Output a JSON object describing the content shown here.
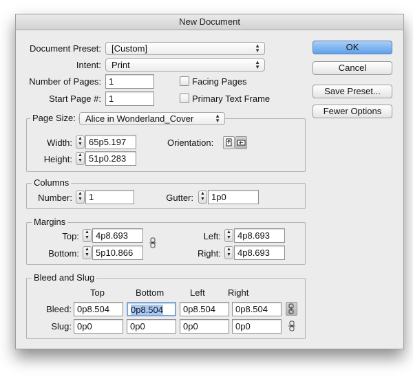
{
  "window": {
    "title": "New Document"
  },
  "preset": {
    "label": "Document Preset:",
    "value": "[Custom]"
  },
  "intent": {
    "label": "Intent:",
    "value": "Print"
  },
  "pages": {
    "number_label": "Number of Pages:",
    "number_value": "1",
    "start_label": "Start Page #:",
    "start_value": "1",
    "facing_label": "Facing Pages",
    "facing_checked": false,
    "primary_label": "Primary Text Frame",
    "primary_checked": false
  },
  "page_size": {
    "label": "Page Size:",
    "value": "Alice in Wonderland_Cover",
    "width_label": "Width:",
    "width_value": "65p5.197",
    "height_label": "Height:",
    "height_value": "51p0.283",
    "orientation_label": "Orientation:",
    "orientation_selected": "landscape"
  },
  "columns": {
    "title": "Columns",
    "number_label": "Number:",
    "number_value": "1",
    "gutter_label": "Gutter:",
    "gutter_value": "1p0"
  },
  "margins": {
    "title": "Margins",
    "top_label": "Top:",
    "top_value": "4p8.693",
    "bottom_label": "Bottom:",
    "bottom_value": "5p10.866",
    "left_label": "Left:",
    "left_value": "4p8.693",
    "right_label": "Right:",
    "right_value": "4p8.693"
  },
  "bleed_slug": {
    "title": "Bleed and Slug",
    "headers": [
      "Top",
      "Bottom",
      "Left",
      "Right"
    ],
    "bleed_label": "Bleed:",
    "bleed_values": [
      "0p8.504",
      "0p8.504",
      "0p8.504",
      "0p8.504"
    ],
    "slug_label": "Slug:",
    "slug_values": [
      "0p0",
      "0p0",
      "0p0",
      "0p0"
    ]
  },
  "buttons": {
    "ok": "OK",
    "cancel": "Cancel",
    "save_preset": "Save Preset...",
    "fewer_options": "Fewer Options"
  },
  "icons": {
    "chain": "chain-link-icon",
    "portrait": "portrait-orientation-icon",
    "landscape": "landscape-orientation-icon"
  },
  "colors": {
    "primary_button": "#6aa6ec",
    "selection_highlight": "#a9c9f2"
  }
}
